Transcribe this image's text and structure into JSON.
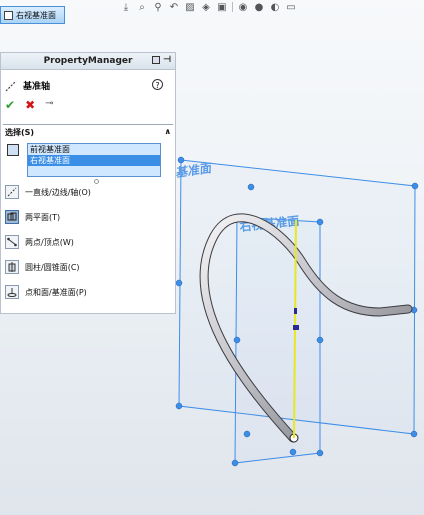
{
  "top_tab": {
    "label": "右视基准面"
  },
  "property_manager": {
    "title": "PropertyManager",
    "feature_name": "基准轴",
    "help": "?",
    "selection": {
      "header": "选择(S)",
      "items": [
        "前视基准面",
        "右视基准面"
      ],
      "active_index": 1
    },
    "options": [
      {
        "label": "一直线/边线/轴(O)",
        "selected": false
      },
      {
        "label": "两平面(T)",
        "selected": true
      },
      {
        "label": "两点/顶点(W)",
        "selected": false
      },
      {
        "label": "圆柱/圆锥面(C)",
        "selected": false
      },
      {
        "label": "点和面/基准面(P)",
        "selected": false
      }
    ]
  },
  "viewport": {
    "front_plane_label": "前视基准面",
    "right_plane_label": "右视基准面",
    "plane_color": "#3e8ee8",
    "axis_color": "#e8e820"
  }
}
